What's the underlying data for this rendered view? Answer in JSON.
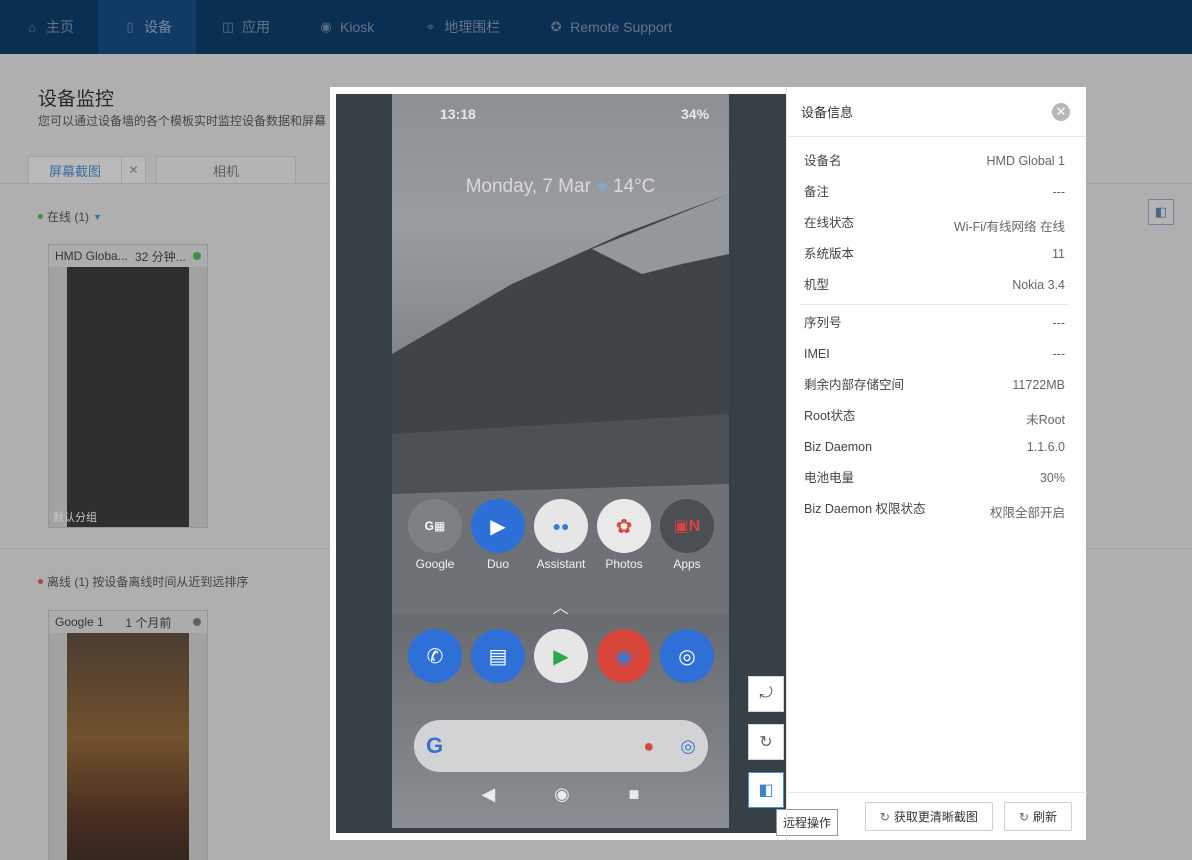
{
  "nav": {
    "items": [
      {
        "label": "主页",
        "icon": "home-icon",
        "glyph": "⌂"
      },
      {
        "label": "设备",
        "icon": "device-icon",
        "glyph": "▯"
      },
      {
        "label": "应用",
        "icon": "bag-icon",
        "glyph": "◫"
      },
      {
        "label": "Kiosk",
        "icon": "kiosk-icon",
        "glyph": "◉"
      },
      {
        "label": "地理围栏",
        "icon": "geofence-icon",
        "glyph": "⌖"
      },
      {
        "label": "Remote Support",
        "icon": "lifebuoy-icon",
        "glyph": "✪"
      }
    ],
    "active_index": 1
  },
  "page": {
    "title": "设备监控",
    "subtitle": "您可以通过设备墙的各个模板实时监控设备数据和屏幕",
    "tabs": [
      "屏幕截图",
      "相机"
    ],
    "online_group": "在线 (1)",
    "offline_group": "离线 (1) 按设备离线时间从近到远排序",
    "cards": [
      {
        "name": "HMD Globa...",
        "time": "32 分钟...",
        "status_color": "#4caf50",
        "footer": "默认分组"
      },
      {
        "name": "Google 1",
        "time": "1 个月前",
        "status_color": "#777777",
        "footer": ""
      }
    ]
  },
  "phone": {
    "time": "13:18",
    "battery": "34%",
    "date_weather": "Monday, 7 Mar",
    "temperature": "14°C",
    "apps_row1": [
      "Google",
      "Duo",
      "Assistant",
      "Photos",
      "Apps"
    ],
    "chevron": "︿"
  },
  "tools": {
    "tooltip": "远程操作"
  },
  "info": {
    "title": "设备信息",
    "rows1": [
      {
        "k": "设备名",
        "v": "HMD Global 1"
      },
      {
        "k": "备注",
        "v": "---"
      },
      {
        "k": "在线状态",
        "v": "Wi-Fi/有线网络 在线"
      },
      {
        "k": "系统版本",
        "v": "11"
      },
      {
        "k": "机型",
        "v": "Nokia 3.4"
      }
    ],
    "rows2": [
      {
        "k": "序列号",
        "v": "---"
      },
      {
        "k": "IMEI",
        "v": "---"
      },
      {
        "k": "剩余内部存储空间",
        "v": "11722MB"
      },
      {
        "k": "Root状态",
        "v": "未Root"
      },
      {
        "k": "Biz Daemon",
        "v": "1.1.6.0"
      },
      {
        "k": "电池电量",
        "v": "30%"
      },
      {
        "k": "Biz Daemon 权限状态",
        "v": "权限全部开启"
      }
    ],
    "btn_clear": "获取更清晰截图",
    "btn_refresh": "刷新"
  }
}
